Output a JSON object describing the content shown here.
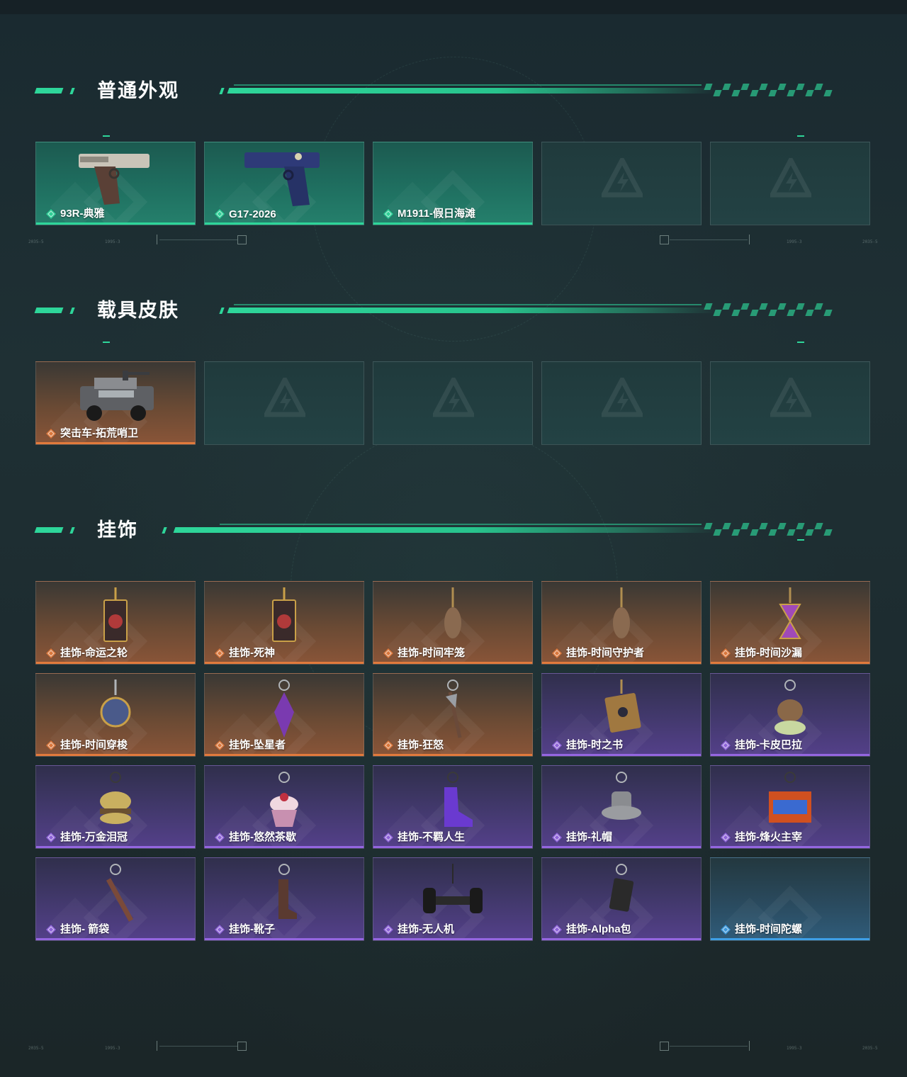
{
  "sections": [
    {
      "title": "普通外观",
      "cards": [
        {
          "label": "93R-典雅",
          "rarity": "green",
          "icon": "pistol-93r-icon"
        },
        {
          "label": "G17-2026",
          "rarity": "green",
          "icon": "pistol-g17-icon"
        },
        {
          "label": "M1911-假日海滩",
          "rarity": "green",
          "icon": ""
        },
        {
          "label": "",
          "rarity": "empty",
          "icon": "placeholder-logo-icon"
        },
        {
          "label": "",
          "rarity": "empty",
          "icon": "placeholder-logo-icon"
        }
      ]
    },
    {
      "title": "载具皮肤",
      "cards": [
        {
          "label": "突击车-拓荒哨卫",
          "rarity": "orange",
          "icon": "assault-vehicle-icon"
        },
        {
          "label": "",
          "rarity": "empty",
          "icon": "placeholder-logo-icon"
        },
        {
          "label": "",
          "rarity": "empty",
          "icon": "placeholder-logo-icon"
        },
        {
          "label": "",
          "rarity": "empty",
          "icon": "placeholder-logo-icon"
        },
        {
          "label": "",
          "rarity": "empty",
          "icon": "placeholder-logo-icon"
        }
      ]
    },
    {
      "title": "挂饰",
      "cards": [
        {
          "label": "挂饰-命运之轮",
          "rarity": "orange",
          "icon": "charm-card-icon"
        },
        {
          "label": "挂饰-死神",
          "rarity": "orange",
          "icon": "charm-card-icon"
        },
        {
          "label": "挂饰-时间牢笼",
          "rarity": "orange",
          "icon": "charm-pendant-icon"
        },
        {
          "label": "挂饰-时间守护者",
          "rarity": "orange",
          "icon": "charm-pendant-icon"
        },
        {
          "label": "挂饰-时间沙漏",
          "rarity": "orange",
          "icon": "charm-hourglass-icon"
        },
        {
          "label": "挂饰-时间穿梭",
          "rarity": "orange",
          "icon": "charm-disc-icon"
        },
        {
          "label": "挂饰-坠星者",
          "rarity": "orange",
          "icon": "charm-crystal-icon"
        },
        {
          "label": "挂饰-狂怒",
          "rarity": "orange",
          "icon": "charm-axe-icon"
        },
        {
          "label": "挂饰-时之书",
          "rarity": "purple",
          "icon": "charm-book-icon"
        },
        {
          "label": "挂饰-卡皮巴拉",
          "rarity": "purple",
          "icon": "charm-capybara-icon"
        },
        {
          "label": "挂饰-万金泪冠",
          "rarity": "purple",
          "icon": "charm-burger-icon"
        },
        {
          "label": "挂饰-悠然茶歇",
          "rarity": "purple",
          "icon": "charm-cupcake-icon"
        },
        {
          "label": "挂饰-不羁人生",
          "rarity": "purple",
          "icon": "charm-sneaker-icon"
        },
        {
          "label": "挂饰-礼帽",
          "rarity": "purple",
          "icon": "charm-hat-icon"
        },
        {
          "label": "挂饰-烽火主宰",
          "rarity": "purple",
          "icon": "charm-graffiti-icon"
        },
        {
          "label": "挂饰- 箭袋",
          "rarity": "purple",
          "icon": "charm-quiver-icon"
        },
        {
          "label": "挂饰-靴子",
          "rarity": "purple",
          "icon": "charm-boot-icon"
        },
        {
          "label": "挂饰-无人机",
          "rarity": "purple",
          "icon": "charm-drone-icon"
        },
        {
          "label": "挂饰-Alpha包",
          "rarity": "purple",
          "icon": "charm-bag-icon"
        },
        {
          "label": "挂饰-时间陀螺",
          "rarity": "blue",
          "icon": ""
        }
      ]
    }
  ],
  "colors": {
    "accent": "#2ed69a",
    "orange": "#e27a3c",
    "purple": "#9466e0",
    "blue": "#3e9fe6"
  }
}
